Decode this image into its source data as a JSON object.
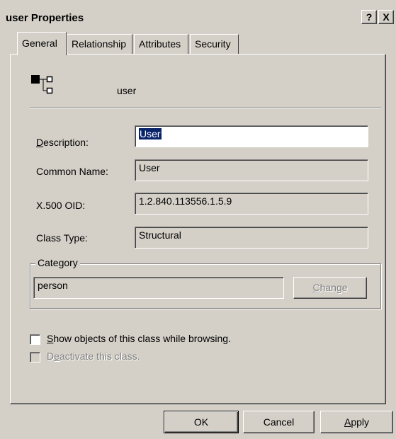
{
  "window": {
    "title": "user Properties",
    "help_label": "?",
    "close_label": "X"
  },
  "tabs": [
    {
      "label": "General",
      "active": true
    },
    {
      "label": "Relationship",
      "active": false
    },
    {
      "label": "Attributes",
      "active": false
    },
    {
      "label": "Security",
      "active": false
    }
  ],
  "header": {
    "icon": "class-hierarchy-icon",
    "class_name": "user"
  },
  "fields": {
    "description": {
      "label_first": "D",
      "label_rest": "escription:",
      "value": "User"
    },
    "common_name": {
      "label": "Common Name:",
      "value": "User"
    },
    "oid": {
      "label": "X.500 OID:",
      "value": "1.2.840.113556.1.5.9"
    },
    "class_type": {
      "label": "Class Type:",
      "value": "Structural"
    }
  },
  "category": {
    "legend": "Category",
    "value": "person",
    "change_first": "C",
    "change_rest": "hange"
  },
  "options": {
    "show_objects": {
      "first": "S",
      "rest": "how objects of this class while browsing.",
      "checked": false
    },
    "deactivate": {
      "pre": "D",
      "ul": "e",
      "rest": "activate this class.",
      "checked": false,
      "disabled": true
    }
  },
  "buttons": {
    "ok": "OK",
    "cancel": "Cancel",
    "apply_first": "A",
    "apply_rest": "pply"
  },
  "colors": {
    "face": "#d4d0c8",
    "selection": "#0a246a"
  }
}
